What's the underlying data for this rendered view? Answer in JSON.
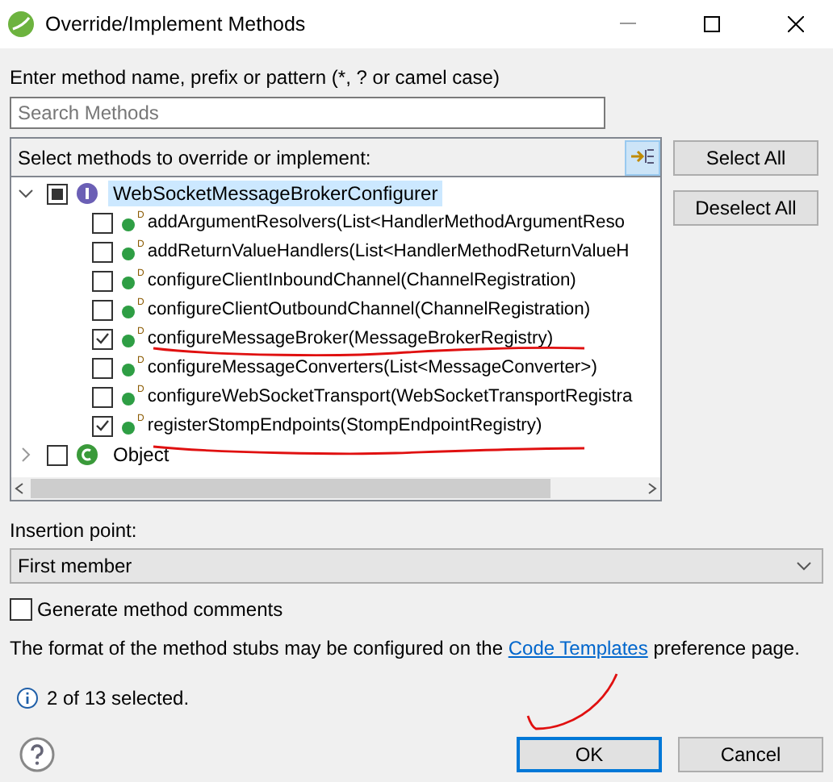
{
  "window": {
    "title": "Override/Implement Methods"
  },
  "filter": {
    "label": "Enter method name, prefix or pattern (*, ? or camel case)",
    "placeholder": "Search Methods"
  },
  "tree": {
    "header": "Select methods to override or implement:",
    "nodes": [
      {
        "label": "WebSocketMessageBrokerConfigurer",
        "kind": "interface",
        "expanded": true,
        "checked": false,
        "partial": true,
        "selected": true,
        "children": [
          {
            "label": "addArgumentResolvers(List<HandlerMethodArgumentReso",
            "marker": "D",
            "checked": false,
            "selected": false
          },
          {
            "label": "addReturnValueHandlers(List<HandlerMethodReturnValueH",
            "marker": "D",
            "checked": false,
            "selected": false
          },
          {
            "label": "configureClientInboundChannel(ChannelRegistration)",
            "marker": "D",
            "checked": false,
            "selected": false
          },
          {
            "label": "configureClientOutboundChannel(ChannelRegistration)",
            "marker": "D",
            "checked": false,
            "selected": false
          },
          {
            "label": "configureMessageBroker(MessageBrokerRegistry)",
            "marker": "D",
            "checked": true,
            "selected": false
          },
          {
            "label": "configureMessageConverters(List<MessageConverter>)",
            "marker": "D",
            "checked": false,
            "selected": false
          },
          {
            "label": "configureWebSocketTransport(WebSocketTransportRegistra",
            "marker": "D",
            "checked": false,
            "selected": false
          },
          {
            "label": "registerStompEndpoints(StompEndpointRegistry)",
            "marker": "D",
            "checked": true,
            "selected": false
          }
        ]
      },
      {
        "label": "Object",
        "kind": "class",
        "expanded": false,
        "checked": false,
        "partial": false,
        "selected": false
      }
    ]
  },
  "side_buttons": [
    "Select All",
    "Deselect All"
  ],
  "insertion": {
    "label": "Insertion point:",
    "value": "First member"
  },
  "generate_comments": {
    "label": "Generate method comments",
    "checked": false
  },
  "note": {
    "before": "The format of the method stubs may be configured on the",
    "link": "Code Templates",
    "after": "preference page."
  },
  "status": "2 of 13 selected.",
  "footer_buttons": [
    {
      "label": "OK",
      "default": true
    },
    {
      "label": "Cancel",
      "default": false
    }
  ]
}
